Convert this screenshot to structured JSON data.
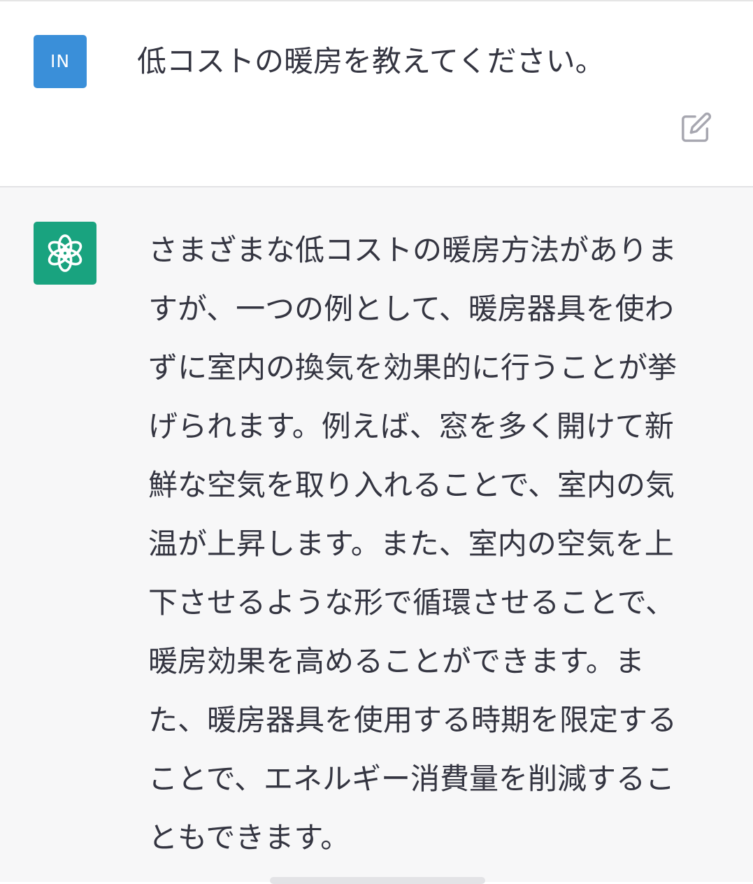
{
  "user_message": {
    "avatar_initials": "IN",
    "text": "低コストの暖房を教えてください。",
    "edit_icon": "edit-icon"
  },
  "assistant_message": {
    "avatar_icon": "openai-logo-icon",
    "lines": [
      "さまざまな低コストの暖房方法がありま",
      "すが、一つの例として、暖房器具を使わ",
      "ずに室内の換気を効果的に行うことが挙",
      "げられます。例えば、窓を多く開けて新",
      "鮮な空気を取り入れることで、室内の気",
      "温が上昇します。また、室内の空気を上",
      "下させるような形で循環させることで、",
      "暖房効果を高めることができます。ま",
      "た、暖房器具を使用する時期を限定する",
      "ことで、エネルギー消費量を削減するこ",
      "ともできます。"
    ]
  },
  "colors": {
    "user_avatar": "#3a8fd9",
    "assistant_avatar": "#19a37f",
    "assistant_background": "#f7f7f8",
    "text": "#343541"
  }
}
